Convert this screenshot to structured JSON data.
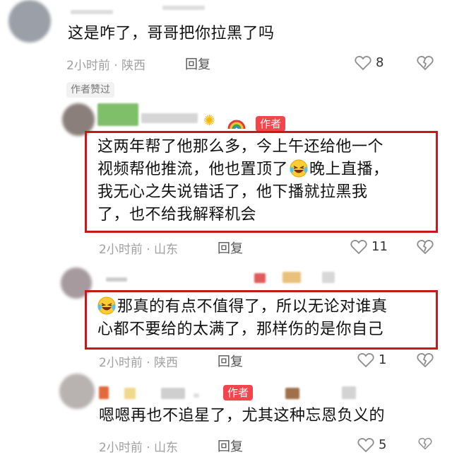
{
  "comments": [
    {
      "text": "这是咋了，哥哥把你拉黑了吗",
      "time_location": "2小时前 · 陕西",
      "reply_label": "回复",
      "like_count": "8",
      "author_liked": "作者赞过"
    },
    {
      "badge": "作者",
      "lines": [
        "这两年帮了他那么多，今上午还给他一个",
        "视频帮他推流，他也置顶了",
        "晚上直播，",
        "我无心之失说错话了，他下播就拉黑我",
        "了，也不给我解释机会"
      ],
      "time_location": "2小时前 · 山东",
      "reply_label": "回复",
      "like_count": "11"
    },
    {
      "lines": [
        "那真的有点不值得了，所以无论对谁真",
        "心都不要给的太满了，那样伤的是你自己"
      ],
      "time_location": "2小时前 · 陕西",
      "reply_label": "回复",
      "like_count": "1"
    },
    {
      "badge": "作者",
      "text": "嗯嗯再也不追星了，尤其这种忘恩负义的",
      "time_location": "2小时前 · 山东",
      "reply_label": "回复",
      "like_count": "5"
    }
  ],
  "icons": {
    "like": "heart-outline-icon",
    "dislike": "broken-heart-icon",
    "emoji": "laughing-tears-emoji",
    "sun": "sun-emoji",
    "rainbow": "rainbow-emoji"
  },
  "colors": {
    "highlight_box": "#c8191a",
    "author_badge": "#f2454c"
  }
}
